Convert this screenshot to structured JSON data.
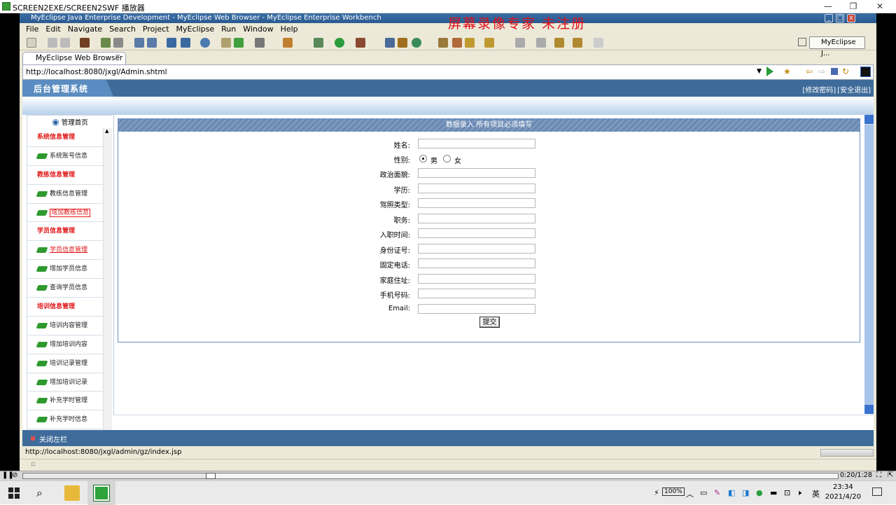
{
  "player": {
    "title": "SCREEN2EXE/SCREEN2SWF 播放器",
    "time": "0:20/1:28",
    "progress_fraction": 0.23
  },
  "watermark": "屏幕录像专家 未注册",
  "ide": {
    "title": "MyEclipse Java Enterprise Development - MyEclipse Web Browser - MyEclipse Enterprise Workbench",
    "menu": [
      "File",
      "Edit",
      "Navigate",
      "Search",
      "Project",
      "MyEclipse",
      "Run",
      "Window",
      "Help"
    ],
    "perspective": "MyEclipse J...",
    "view_tab": "MyEclipse Web Browser",
    "url": "http://localhost:8080/jxgl/Admin.shtml",
    "status": "http://localhost:8080/jxgl/admin/gz/index.jsp"
  },
  "page": {
    "logo": "后台管理系统",
    "links": [
      "[修改密码]",
      "[安全退出]"
    ],
    "sidebar_head": "管理首页",
    "sidebar": [
      {
        "type": "cat",
        "label": "系统信息管理"
      },
      {
        "type": "link",
        "label": "系统账号信息"
      },
      {
        "type": "cat",
        "label": "教练信息管理"
      },
      {
        "type": "link",
        "label": "教练信息管理"
      },
      {
        "type": "link",
        "label": "增加教练信息",
        "style": "hl"
      },
      {
        "type": "cat",
        "label": "学员信息管理"
      },
      {
        "type": "link",
        "label": "学员信息管理",
        "style": "ul"
      },
      {
        "type": "link",
        "label": "增加学员信息"
      },
      {
        "type": "link",
        "label": "查询学员信息"
      },
      {
        "type": "cat",
        "label": "培训信息管理"
      },
      {
        "type": "link",
        "label": "培训内容管理"
      },
      {
        "type": "link",
        "label": "增加培训内容"
      },
      {
        "type": "link",
        "label": "培训记录管理"
      },
      {
        "type": "link",
        "label": "增加培训记录"
      },
      {
        "type": "link",
        "label": "补充学时管理"
      },
      {
        "type": "link",
        "label": "补充学时信息"
      }
    ],
    "close_left": "关闭左栏",
    "form": {
      "title": "数据录入 所有项目必须填写",
      "fields": {
        "name": "姓名:",
        "gender": "性别:",
        "political": "政治面貌:",
        "education": "学历:",
        "license": "驾照类型:",
        "position": "职务:",
        "hire_date": "入职时间:",
        "id_number": "身份证号:",
        "phone": "固定电话:",
        "address": "家庭住址:",
        "mobile": "手机号码:",
        "email": "Email:"
      },
      "gender_options": [
        "男",
        "女"
      ],
      "submit": "提交"
    }
  },
  "taskbar": {
    "time": "23:34",
    "date": "2021/4/20",
    "battery": "100%",
    "ime": "英"
  }
}
